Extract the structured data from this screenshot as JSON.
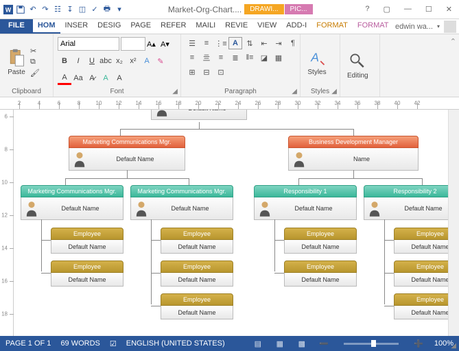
{
  "titlebar": {
    "doc_title": "Market-Org-Chart....",
    "ctx_tab1": "DRAWI...",
    "ctx_tab2": "PIC..."
  },
  "ribbon_tabs": {
    "file": "FILE",
    "tabs": [
      "HOM",
      "INSER",
      "DESIG",
      "PAGE",
      "REFER",
      "MAILI",
      "REVIE",
      "VIEW",
      "ADD-I",
      "FORMAT",
      "FORMAT"
    ],
    "user": "edwin wa..."
  },
  "ribbon": {
    "clipboard": {
      "paste": "Paste",
      "label": "Clipboard"
    },
    "font": {
      "name": "Arial",
      "size": "",
      "label": "Font"
    },
    "paragraph": {
      "label": "Paragraph"
    },
    "styles": {
      "btn": "Styles",
      "label": "Styles"
    },
    "editing": {
      "btn": "Editing"
    }
  },
  "ruler_h": [
    2,
    4,
    6,
    8,
    10,
    12,
    14,
    16,
    18,
    20,
    22,
    24,
    26,
    28,
    30,
    32,
    34,
    36,
    38,
    40,
    42
  ],
  "ruler_v": [
    6,
    8,
    10,
    12,
    14,
    16,
    18
  ],
  "org": {
    "top": {
      "name": "Default Name"
    },
    "level2": [
      {
        "title": "Marketing Communications Mgr.",
        "name": "Default Name"
      },
      {
        "title": "Business Development Manager",
        "name": "Name"
      }
    ],
    "level3": [
      {
        "title": "Marketing Communications Mgr.",
        "name": "Default Name"
      },
      {
        "title": "Marketing Communications Mgr.",
        "name": "Default Name"
      },
      {
        "title": "Responsibility 1",
        "name": "Default Name"
      },
      {
        "title": "Responsibility 2",
        "name": "Default Name"
      }
    ],
    "employee_title": "Employee",
    "employee_name": "Default Name"
  },
  "statusbar": {
    "page": "PAGE 1 OF 1",
    "words": "69 WORDS",
    "lang": "ENGLISH (UNITED STATES)",
    "zoom": "100%"
  }
}
